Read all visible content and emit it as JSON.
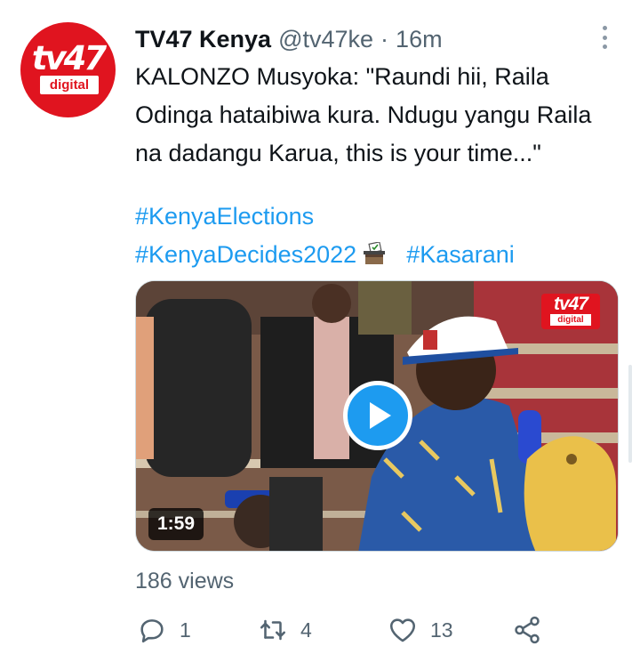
{
  "tweet": {
    "author_name": "TV47 Kenya",
    "handle": "@tv47ke",
    "separator": "·",
    "time": "16m",
    "text": "KALONZO Musyoka: \"Raundi hii, Raila Odinga hataibiwa kura. Ndugu yangu Raila na dadangu Karua, this is your time...\"",
    "hashtags": [
      "#KenyaElections",
      "#KenyaDecides2022",
      "#Kasarani"
    ],
    "avatar_logo_text": "tv47",
    "avatar_logo_sub": "digital"
  },
  "media": {
    "duration": "1:59",
    "logo_text": "tv47",
    "logo_sub": "digital"
  },
  "views": "186 views",
  "actions": {
    "replies": "1",
    "retweets": "4",
    "likes": "13"
  },
  "colors": {
    "brand_red": "#e0141f",
    "link_blue": "#1d9bf0",
    "muted": "#536471",
    "text": "#0f1419"
  },
  "icons": [
    "more-vertical-icon",
    "ballot-box-icon",
    "play-icon",
    "reply-icon",
    "retweet-icon",
    "like-icon",
    "share-icon"
  ]
}
